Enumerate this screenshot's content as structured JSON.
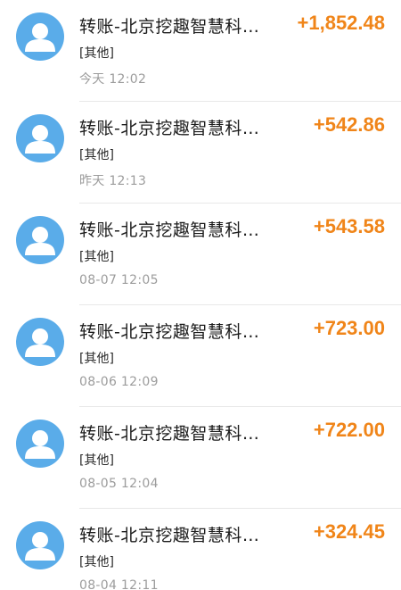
{
  "transactions": [
    {
      "title": "转账-北京挖趣智慧科…",
      "amount": "+1,852.48",
      "tag": "[其他]",
      "time": "今天  12:02"
    },
    {
      "title": "转账-北京挖趣智慧科…",
      "amount": "+542.86",
      "tag": "[其他]",
      "time": "昨天  12:13"
    },
    {
      "title": "转账-北京挖趣智慧科…",
      "amount": "+543.58",
      "tag": "[其他]",
      "time": "08-07  12:05"
    },
    {
      "title": "转账-北京挖趣智慧科…",
      "amount": "+723.00",
      "tag": "[其他]",
      "time": "08-06  12:09"
    },
    {
      "title": "转账-北京挖趣智慧科…",
      "amount": "+722.00",
      "tag": "[其他]",
      "time": "08-05  12:04"
    },
    {
      "title": "转账-北京挖趣智慧科…",
      "amount": "+324.45",
      "tag": "[其他]",
      "time": "08-04  12:11"
    }
  ],
  "colors": {
    "avatar": "#5aace9",
    "amount": "#f08519"
  },
  "icons": {
    "avatar": "user-avatar-icon"
  }
}
